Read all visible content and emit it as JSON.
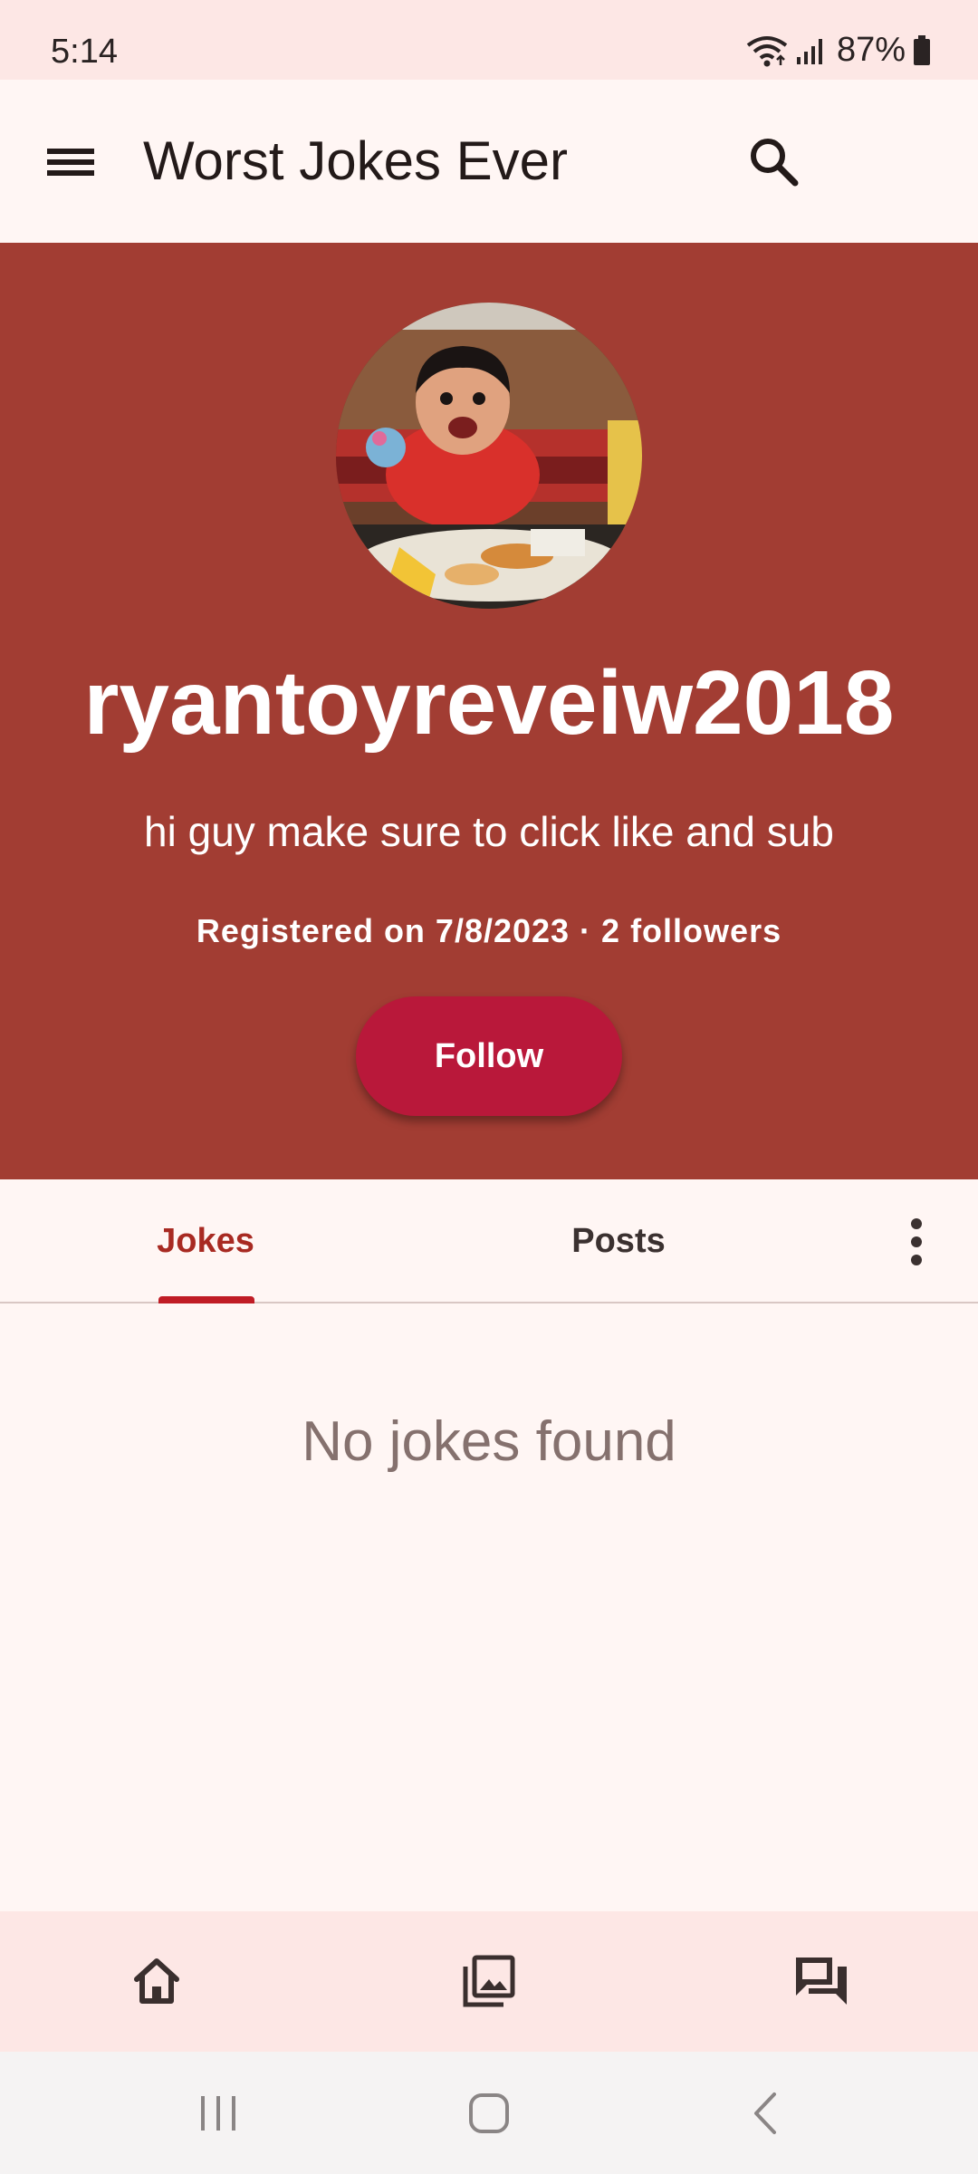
{
  "status_bar": {
    "time": "5:14",
    "battery": "87%",
    "icons": [
      "wifi-icon",
      "signal-icon",
      "battery-icon"
    ]
  },
  "app_bar": {
    "title": "Worst Jokes Ever",
    "menu_icon": "menu-icon",
    "search_icon": "search-icon"
  },
  "profile": {
    "username": "ryantoyreveiw2018",
    "bio": "hi guy make sure to click like and sub",
    "meta": "Registered on 7/8/2023 · 2 followers",
    "follow_label": "Follow"
  },
  "tabs": [
    {
      "label": "Jokes",
      "selected": true
    },
    {
      "label": "Posts",
      "selected": false
    }
  ],
  "more_icon": "more-vert-icon",
  "empty_state": "No jokes found",
  "bottom_nav": [
    "home-icon",
    "gallery-icon",
    "forum-icon"
  ],
  "system_nav": [
    "recent-apps-icon",
    "home-button-icon",
    "back-icon"
  ],
  "colors": {
    "header_bg": "#a23d33",
    "follow_button": "#b9183a",
    "accent": "#a82a22",
    "surface": "#fff6f4",
    "nav_bg": "#fde7e5"
  }
}
